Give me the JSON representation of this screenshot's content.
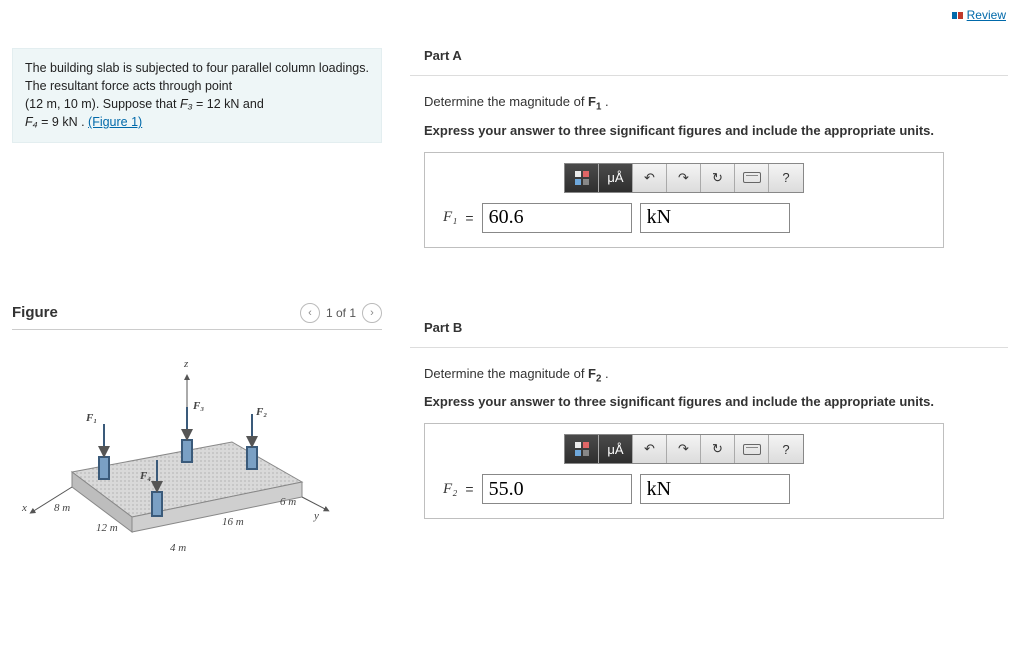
{
  "review_label": "Review",
  "problem": {
    "line1": "The building slab is subjected to four parallel column loadings. The resultant force acts through point",
    "line2_prefix": "(12 m, 10 m). Suppose that ",
    "f3_var": "F₃",
    "f3_eq": " = 12  kN",
    "and_word": " and",
    "f4_var": "F₄",
    "f4_eq": " = 9  kN . ",
    "figure_link": "(Figure 1)"
  },
  "figure": {
    "heading": "Figure",
    "pager": "1 of 1",
    "labels": {
      "z": "z",
      "x": "x",
      "y": "y",
      "F1": "F₁",
      "F2": "F₂",
      "F3": "F₃",
      "F4": "F₄",
      "d8": "8 m",
      "d12": "12 m",
      "d16": "16 m",
      "d6": "6 m",
      "d4": "4 m"
    }
  },
  "partA": {
    "title": "Part A",
    "question_pre": "Determine the magnitude of ",
    "question_var": "F",
    "question_sub": "1",
    "instruction": "Express your answer to three significant figures and include the appropriate units.",
    "var_label": "F₁",
    "eq": " = ",
    "value": "60.6",
    "unit": "kN"
  },
  "partB": {
    "title": "Part B",
    "question_pre": "Determine the magnitude of ",
    "question_var": "F",
    "question_sub": "2",
    "instruction": "Express your answer to three significant figures and include the appropriate units.",
    "var_label": "F₂",
    "eq": " = ",
    "value": "55.0",
    "unit": "kN"
  },
  "toolbar": {
    "units_hint": "μÅ",
    "help": "?"
  }
}
